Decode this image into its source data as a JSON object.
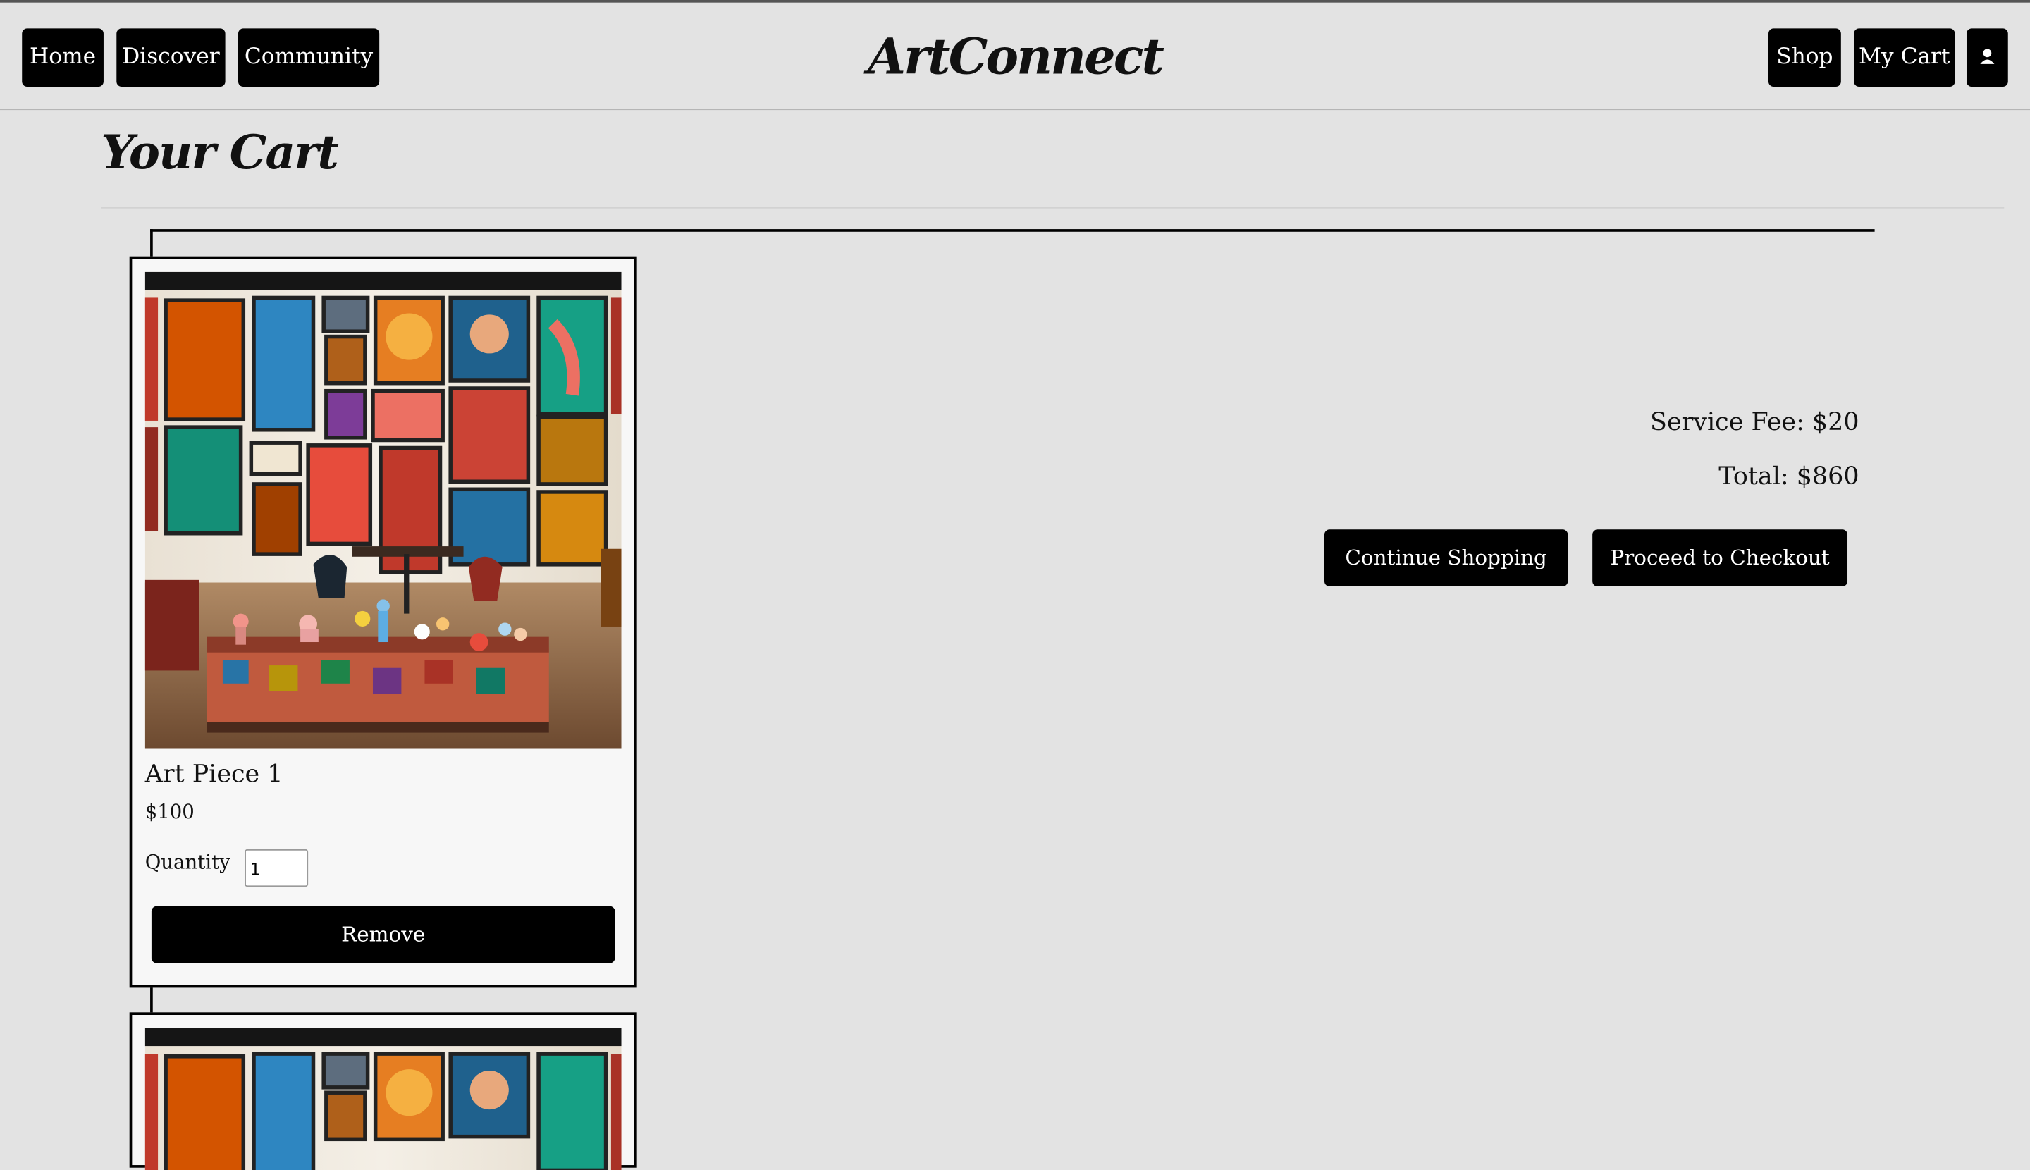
{
  "header": {
    "nav_left": [
      "Home",
      "Discover",
      "Community"
    ],
    "logo": "ArtConnect",
    "nav_right": [
      "Shop",
      "My Cart"
    ],
    "profile_icon": "user-icon"
  },
  "page": {
    "title": "Your Cart"
  },
  "cart_items": [
    {
      "name": "Art Piece 1",
      "price": "$100",
      "quantity_label": "Quantity",
      "quantity": "1",
      "remove_label": "Remove",
      "image": "gallery-room-image"
    },
    {
      "name": "",
      "price": "",
      "quantity_label": "",
      "quantity": "",
      "remove_label": "",
      "image": "gallery-room-image"
    }
  ],
  "summary": {
    "service_fee": "Service Fee: $20",
    "total": "Total: $860",
    "continue_label": "Continue Shopping",
    "checkout_label": "Proceed to Checkout"
  },
  "colors": {
    "background": "#e3e3e3",
    "button": "#000000",
    "button_text": "#ffffff",
    "card": "#f7f7f7"
  }
}
